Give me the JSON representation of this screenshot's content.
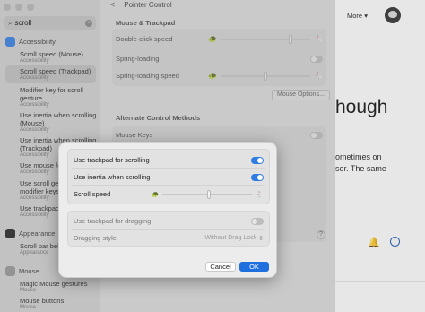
{
  "sidebar": {
    "search_value": "scroll",
    "categories": {
      "accessibility": "Accessibility",
      "appearance": "Appearance",
      "mouse": "Mouse"
    },
    "results": [
      {
        "title": "Scroll speed (Mouse)",
        "sub": "Accessibility"
      },
      {
        "title": "Scroll speed (Trackpad)",
        "sub": "Accessibility"
      },
      {
        "title": "Modifier key for scroll gesture",
        "sub": "Accessibility"
      },
      {
        "title": "Use inertia when scrolling (Mouse)",
        "sub": "Accessibility"
      },
      {
        "title": "Use inertia when scrolling (Trackpad)",
        "sub": "Accessibility"
      },
      {
        "title": "Use mouse fo",
        "sub": "Accessibility"
      },
      {
        "title": "Use scroll ge modifier keys",
        "sub": "Accessibility"
      },
      {
        "title": "Use trackpad",
        "sub": "Accessibility"
      },
      {
        "title": "Scroll bar behavior",
        "sub": "Appearance"
      },
      {
        "title": "Magic Mouse gestures",
        "sub": "Mouse"
      },
      {
        "title": "Mouse buttons",
        "sub": "Mouse"
      }
    ]
  },
  "main": {
    "back_label": "<",
    "title": "Pointer Control",
    "section1": "Mouse & Trackpad",
    "double_click": "Double-click speed",
    "spring_loading": "Spring-loading",
    "spring_loading_speed": "Spring-loading speed",
    "mouse_options": "Mouse Options...",
    "section2": "Alternate Control Methods",
    "mouse_keys": "Mouse Keys",
    "help": "?"
  },
  "right": {
    "more": "More",
    "heading": "hough",
    "para1": "ometimes on",
    "para2": "ser. The same"
  },
  "modal": {
    "use_trackpad_scrolling": "Use trackpad for scrolling",
    "use_inertia": "Use inertia when scrolling",
    "scroll_speed": "Scroll speed",
    "use_trackpad_dragging": "Use trackpad for dragging",
    "dragging_style": "Dragging style",
    "dragging_style_value": "Without Drag Lock",
    "cancel": "Cancel",
    "ok": "OK",
    "scroll_speed_level": 0.52
  },
  "colors": {
    "accent": "#1f6fde",
    "toggle_on": "#2f7de1"
  }
}
